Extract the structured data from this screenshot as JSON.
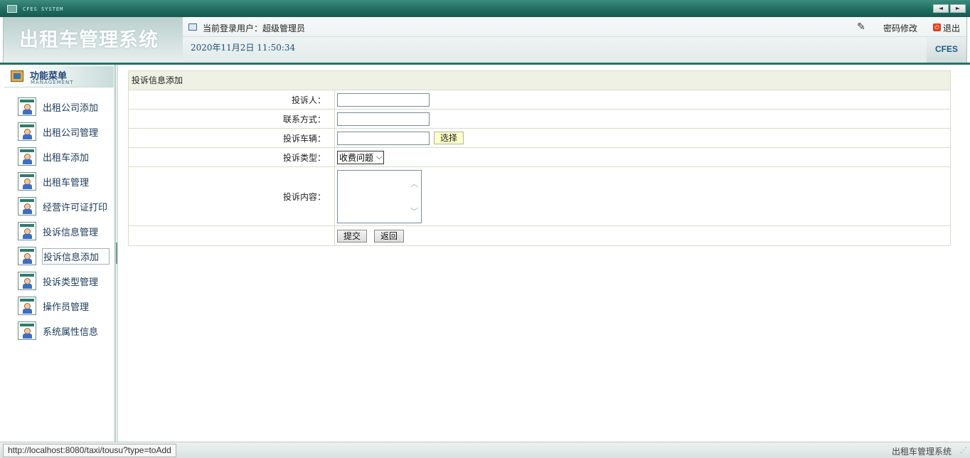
{
  "titlebar": {
    "system_text": "CFES SYSTEM",
    "prev": "◄",
    "next": "►"
  },
  "header": {
    "logo_text": "出租车管理系统",
    "user_label": "当前登录用户：超级管理员",
    "datetime": "2020年11月2日 11:50:34",
    "change_password": "密码修改",
    "logout": "退出",
    "brand": "CFES"
  },
  "sidebar": {
    "title": "功能菜单",
    "subtitle": "MANAGEMENT",
    "items": [
      {
        "label": "出租公司添加"
      },
      {
        "label": "出租公司管理"
      },
      {
        "label": "出租车添加"
      },
      {
        "label": "出租车管理"
      },
      {
        "label": "经营许可证打印"
      },
      {
        "label": "投诉信息管理"
      },
      {
        "label": "投诉信息添加"
      },
      {
        "label": "投诉类型管理"
      },
      {
        "label": "操作员管理"
      },
      {
        "label": "系统属性信息"
      }
    ],
    "active_index": 6
  },
  "form": {
    "title": "投诉信息添加",
    "complainant_label": "投诉人：",
    "complainant_value": "",
    "contact_label": "联系方式：",
    "contact_value": "",
    "vehicle_label": "投诉车辆：",
    "vehicle_value": "",
    "choose_button": "选择",
    "type_label": "投诉类型：",
    "type_selected": "收费问题",
    "content_label": "投诉内容：",
    "content_value": "",
    "submit_button": "提交",
    "back_button": "返回"
  },
  "statusbar": {
    "url": "http://localhost:8080/taxi/tousu?type=toAdd",
    "right_text": "出租车管理系统"
  }
}
